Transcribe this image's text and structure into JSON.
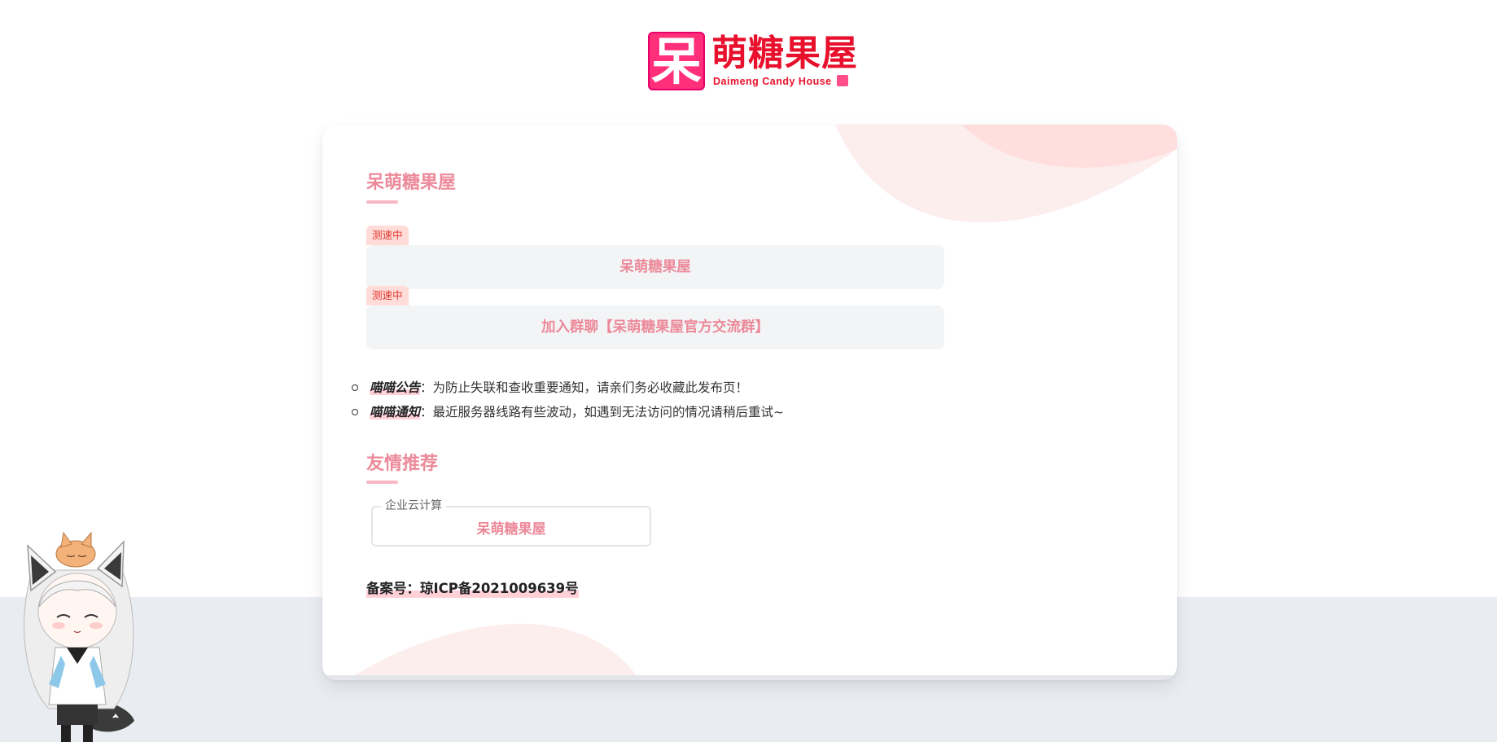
{
  "logo": {
    "mark_glyph": "呆",
    "title_cn": "萌糖果屋",
    "subtitle_en": "Daimeng Candy House"
  },
  "main": {
    "section_title": "呆萌糖果屋",
    "lines": [
      {
        "tag": "测速中",
        "label": "呆萌糖果屋"
      },
      {
        "tag": "测速中",
        "label": "加入群聊【呆萌糖果屋官方交流群】"
      }
    ],
    "notices": [
      {
        "title": "喵喵公告",
        "sep": "：",
        "text": "为防止失联和查收重要通知，请亲们务必收藏此发布页！"
      },
      {
        "title": "喵喵通知",
        "sep": "：",
        "text": "最近服务器线路有些波动，如遇到无法访问的情况请稍后重试~"
      }
    ]
  },
  "friends": {
    "section_title": "友情推荐",
    "box_legend": "企业云计算",
    "link_label": "呆萌糖果屋"
  },
  "footer": {
    "icp": "备案号：琼ICP备2021009639号"
  },
  "colors": {
    "accent_pink": "#ec8a9a",
    "logo_red": "#e8102c",
    "tag_red": "#e0322e",
    "tag_bg": "#ffdcd7",
    "button_bg": "#f3f4f6",
    "page_bottom_bg": "#e9ecf0"
  }
}
